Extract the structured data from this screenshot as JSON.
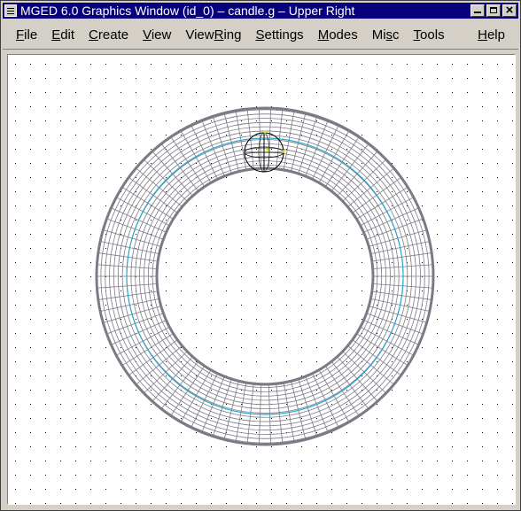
{
  "window": {
    "title": "MGED 6.0 Graphics Window (id_0) – candle.g – Upper Right"
  },
  "menubar": {
    "items": [
      {
        "mn": "F",
        "rest": "ile"
      },
      {
        "mn": "E",
        "rest": "dit"
      },
      {
        "mn": "C",
        "rest": "reate"
      },
      {
        "mn": "V",
        "rest": "iew"
      },
      {
        "pre": "View",
        "mn": "R",
        "rest": "ing"
      },
      {
        "mn": "S",
        "rest": "ettings"
      },
      {
        "mn": "M",
        "rest": "odes"
      },
      {
        "pre": "Mi",
        "mn": "s",
        "rest": "c"
      },
      {
        "mn": "T",
        "rest": "ools"
      }
    ],
    "help": {
      "mn": "H",
      "rest": "elp"
    }
  },
  "viewport": {
    "background": "#ffffff",
    "wireframe_color": "#7b7b85",
    "centerline_color": "#2aa7d0",
    "sphere_color": "#000000",
    "point_color": "#e0e000",
    "grid_color": "#000000"
  },
  "icons": [
    "window-menu-icon",
    "minimize-icon",
    "maximize-icon",
    "close-icon"
  ]
}
